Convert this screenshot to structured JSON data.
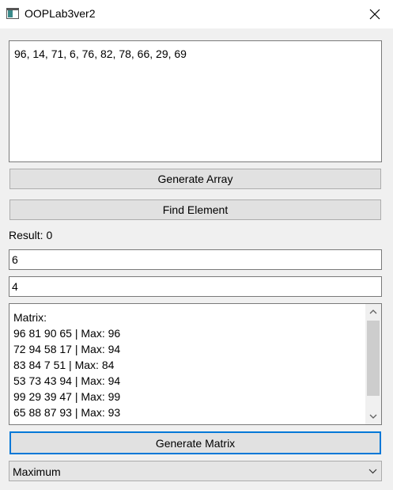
{
  "window": {
    "title": "OOPLab3ver2"
  },
  "array": {
    "text": "96, 14, 71, 6, 76, 82, 78, 66, 29, 69"
  },
  "buttons": {
    "generate_array": "Generate Array",
    "find_element": "Find Element",
    "generate_matrix": "Generate Matrix"
  },
  "result": {
    "label": "Result: 0"
  },
  "inputs": {
    "first": "6",
    "second": "4"
  },
  "matrix": {
    "lines": [
      "Matrix:",
      "96 81 90 65  | Max: 96",
      "72 94 58 17  | Max: 94",
      "83 84 7 51  | Max: 84",
      "53 73 43 94  | Max: 94",
      "99 29 39 47  | Max: 99",
      "65 88 87 93  | Max: 93"
    ]
  },
  "mode_select": {
    "selected": "Maximum"
  },
  "icons": {
    "app": "window-app-icon",
    "close": "close-icon",
    "scroll_up": "chevron-up-icon",
    "scroll_down": "chevron-down-icon",
    "dropdown": "chevron-down-icon"
  },
  "colors": {
    "focus_border": "#0078d7",
    "button_face": "#e1e1e1",
    "window_bg": "#f0f0f0"
  }
}
